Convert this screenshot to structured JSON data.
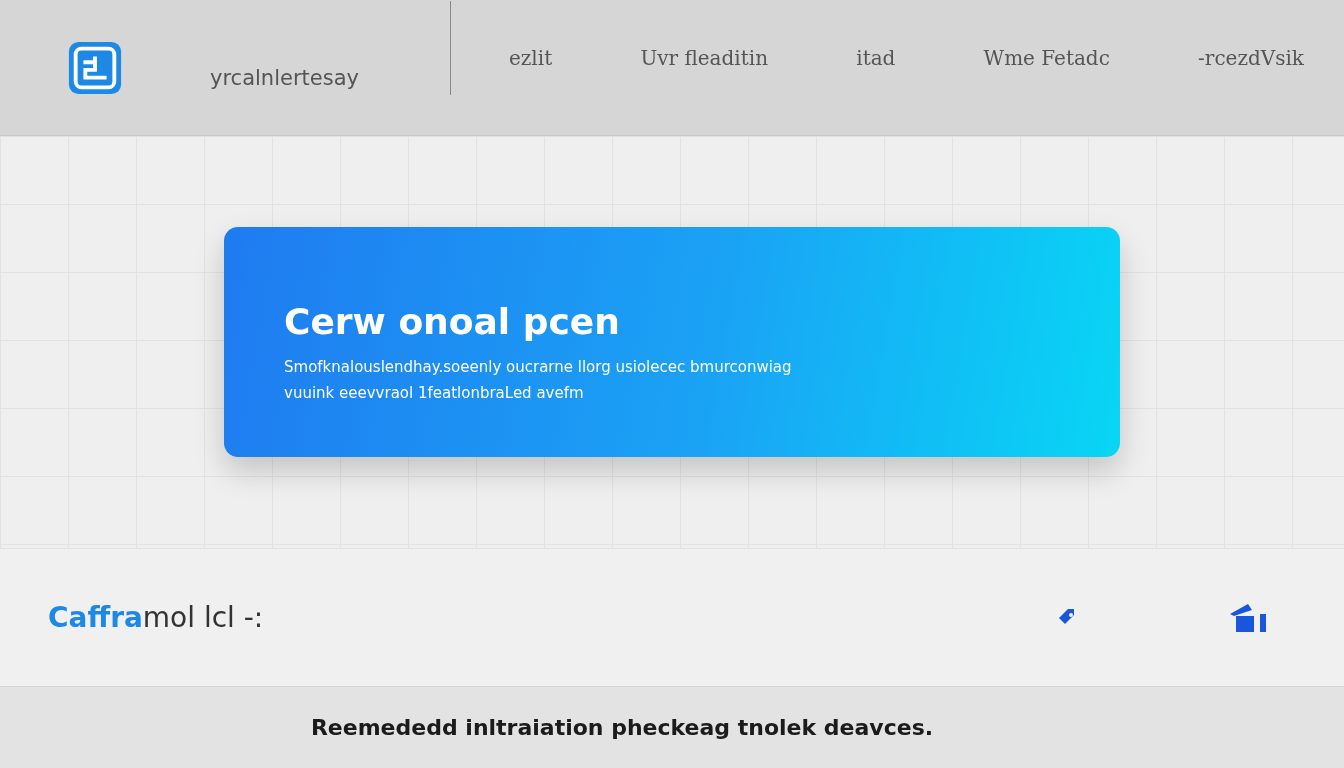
{
  "header": {
    "brand": "yrcalnlertesay",
    "nav": [
      {
        "label": "ezlit"
      },
      {
        "label": "Uvr fleaditin"
      },
      {
        "label": "itad"
      },
      {
        "label": "Wme Fetadc"
      },
      {
        "label": "-rcezdVsik"
      }
    ]
  },
  "hero": {
    "title": "Cerw onoal pcen",
    "body": "Smofknalouslendhay.soeenly oucrarne llorg usiolecec bmurconwiag vuuink eeevvraol 1featlonbraLed avefm"
  },
  "feature_bar": {
    "brand_accent": "Caffra",
    "brand_rest": "mol lcl -:"
  },
  "footer": {
    "text": "Reemededd inltraiation pheckeag tnolek deavces."
  }
}
